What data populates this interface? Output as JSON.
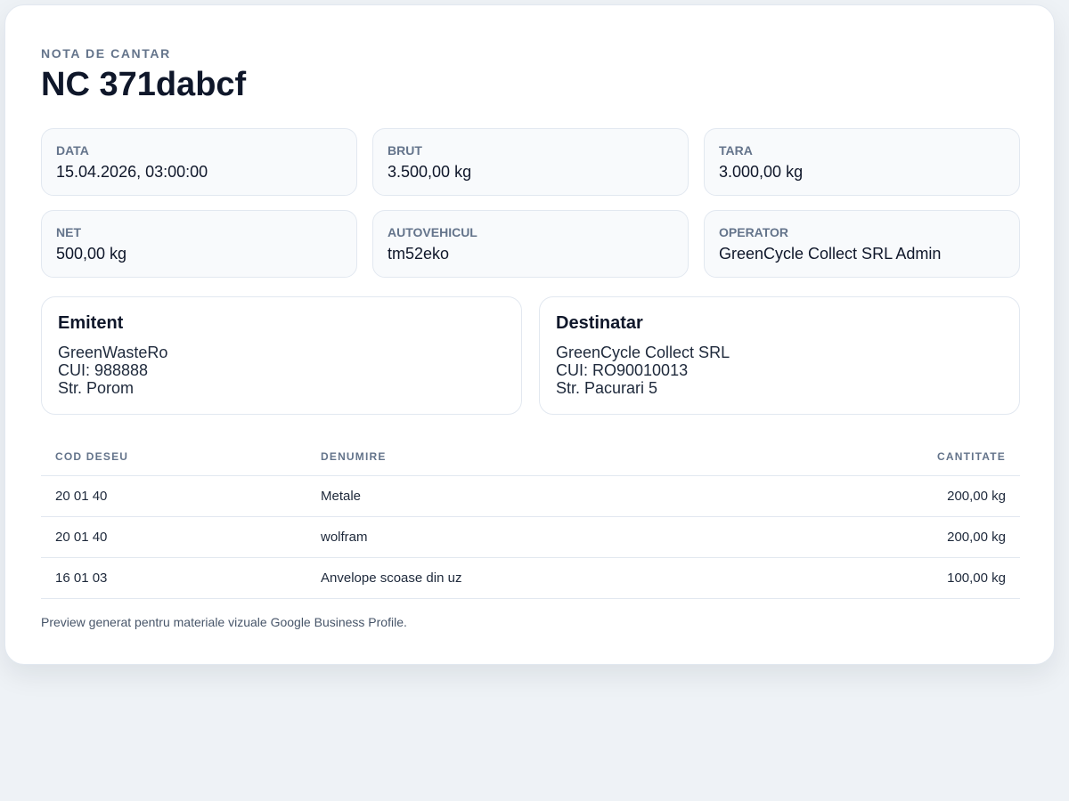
{
  "header": {
    "eyebrow": "NOTA DE CANTAR",
    "title": "NC 371dabcf"
  },
  "info": [
    {
      "label": "DATA",
      "value": "15.04.2026, 03:00:00"
    },
    {
      "label": "BRUT",
      "value": "3.500,00 kg"
    },
    {
      "label": "TARA",
      "value": "3.000,00 kg"
    },
    {
      "label": "NET",
      "value": "500,00 kg"
    },
    {
      "label": "AUTOVEHICUL",
      "value": "tm52eko"
    },
    {
      "label": "OPERATOR",
      "value": "GreenCycle Collect SRL Admin"
    }
  ],
  "emitent": {
    "title": "Emitent",
    "name": "GreenWasteRo",
    "cui": "CUI: 988888",
    "address": "Str. Porom"
  },
  "destinatar": {
    "title": "Destinatar",
    "name": "GreenCycle Collect SRL",
    "cui": "CUI: RO90010013",
    "address": "Str. Pacurari 5"
  },
  "table": {
    "headers": {
      "code": "COD DESEU",
      "name": "DENUMIRE",
      "quantity": "CANTITATE"
    },
    "rows": [
      {
        "code": "20 01 40",
        "name": "Metale",
        "quantity": "200,00 kg"
      },
      {
        "code": "20 01 40",
        "name": "wolfram",
        "quantity": "200,00 kg"
      },
      {
        "code": "16 01 03",
        "name": "Anvelope scoase din uz",
        "quantity": "100,00 kg"
      }
    ]
  },
  "footer": {
    "note": "Preview generat pentru materiale vizuale Google Business Profile."
  },
  "colors": {
    "page_background": "#eef2f6",
    "card_background": "#ffffff",
    "box_background": "#f8fafc",
    "border": "#e2e8f0",
    "muted_text": "#64748b",
    "primary_text": "#0f172a"
  }
}
